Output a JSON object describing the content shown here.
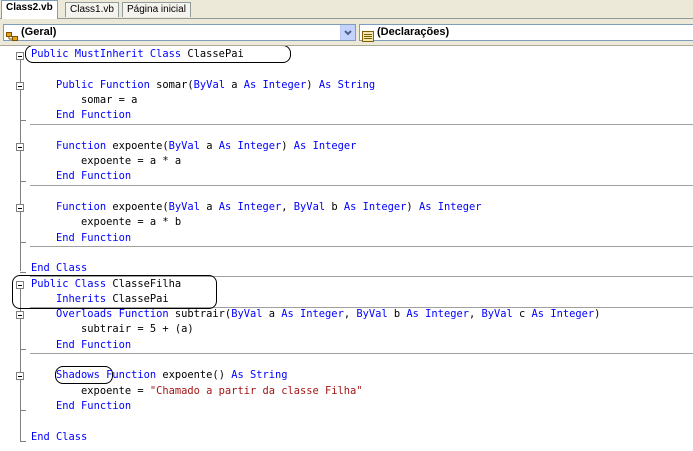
{
  "tabs": [
    {
      "label": "Class2.vb",
      "active": true
    },
    {
      "label": "Class1.vb",
      "active": false
    },
    {
      "label": "Página inicial",
      "active": false
    }
  ],
  "dropdowns": {
    "left": {
      "label": "(Geral)",
      "icon": "class-icon"
    },
    "right": {
      "label": "(Declarações)",
      "icon": "members-icon"
    }
  },
  "colors": {
    "keyword": "#0000ff",
    "string": "#a31515",
    "text": "#000000"
  },
  "code": [
    [
      {
        "t": "kw",
        "v": "Public MustInherit Class "
      },
      {
        "t": "plain",
        "v": "ClassePai"
      }
    ],
    [],
    [
      {
        "t": "plain",
        "v": "    "
      },
      {
        "t": "kw",
        "v": "Public Function "
      },
      {
        "t": "plain",
        "v": "somar("
      },
      {
        "t": "kw",
        "v": "ByVal "
      },
      {
        "t": "plain",
        "v": "a "
      },
      {
        "t": "kw",
        "v": "As Integer"
      },
      {
        "t": "plain",
        "v": ") "
      },
      {
        "t": "kw",
        "v": "As String"
      }
    ],
    [
      {
        "t": "plain",
        "v": "        somar = a"
      }
    ],
    [
      {
        "t": "plain",
        "v": "    "
      },
      {
        "t": "kw",
        "v": "End Function"
      }
    ],
    [],
    [
      {
        "t": "plain",
        "v": "    "
      },
      {
        "t": "kw",
        "v": "Function "
      },
      {
        "t": "plain",
        "v": "expoente("
      },
      {
        "t": "kw",
        "v": "ByVal "
      },
      {
        "t": "plain",
        "v": "a "
      },
      {
        "t": "kw",
        "v": "As Integer"
      },
      {
        "t": "plain",
        "v": ") "
      },
      {
        "t": "kw",
        "v": "As Integer"
      }
    ],
    [
      {
        "t": "plain",
        "v": "        expoente = a * a"
      }
    ],
    [
      {
        "t": "plain",
        "v": "    "
      },
      {
        "t": "kw",
        "v": "End Function"
      }
    ],
    [],
    [
      {
        "t": "plain",
        "v": "    "
      },
      {
        "t": "kw",
        "v": "Function "
      },
      {
        "t": "plain",
        "v": "expoente("
      },
      {
        "t": "kw",
        "v": "ByVal "
      },
      {
        "t": "plain",
        "v": "a "
      },
      {
        "t": "kw",
        "v": "As Integer"
      },
      {
        "t": "plain",
        "v": ", "
      },
      {
        "t": "kw",
        "v": "ByVal "
      },
      {
        "t": "plain",
        "v": "b "
      },
      {
        "t": "kw",
        "v": "As Integer"
      },
      {
        "t": "plain",
        "v": ") "
      },
      {
        "t": "kw",
        "v": "As Integer"
      }
    ],
    [
      {
        "t": "plain",
        "v": "        expoente = a * b"
      }
    ],
    [
      {
        "t": "plain",
        "v": "    "
      },
      {
        "t": "kw",
        "v": "End Function"
      }
    ],
    [],
    [
      {
        "t": "kw",
        "v": "End Class"
      }
    ],
    [
      {
        "t": "kw",
        "v": "Public Class "
      },
      {
        "t": "plain",
        "v": "ClasseFilha"
      }
    ],
    [
      {
        "t": "plain",
        "v": "    "
      },
      {
        "t": "kw",
        "v": "Inherits "
      },
      {
        "t": "plain",
        "v": "ClassePai"
      }
    ],
    [
      {
        "t": "plain",
        "v": "    "
      },
      {
        "t": "kw",
        "v": "Overloads Function "
      },
      {
        "t": "plain",
        "v": "subtrair("
      },
      {
        "t": "kw",
        "v": "ByVal "
      },
      {
        "t": "plain",
        "v": "a "
      },
      {
        "t": "kw",
        "v": "As Integer"
      },
      {
        "t": "plain",
        "v": ", "
      },
      {
        "t": "kw",
        "v": "ByVal "
      },
      {
        "t": "plain",
        "v": "b "
      },
      {
        "t": "kw",
        "v": "As Integer"
      },
      {
        "t": "plain",
        "v": ", "
      },
      {
        "t": "kw",
        "v": "ByVal "
      },
      {
        "t": "plain",
        "v": "c "
      },
      {
        "t": "kw",
        "v": "As Integer"
      },
      {
        "t": "plain",
        "v": ")"
      }
    ],
    [
      {
        "t": "plain",
        "v": "        subtrair = 5 + (a)"
      }
    ],
    [
      {
        "t": "plain",
        "v": "    "
      },
      {
        "t": "kw",
        "v": "End Function"
      }
    ],
    [],
    [
      {
        "t": "plain",
        "v": "    "
      },
      {
        "t": "kw",
        "v": "Shadows "
      },
      {
        "t": "kw",
        "v": "Function "
      },
      {
        "t": "plain",
        "v": "expoente() "
      },
      {
        "t": "kw",
        "v": "As String"
      }
    ],
    [
      {
        "t": "plain",
        "v": "        expoente = "
      },
      {
        "t": "str",
        "v": "\"Chamado a partir da classe Filha\""
      }
    ],
    [
      {
        "t": "plain",
        "v": "    "
      },
      {
        "t": "kw",
        "v": "End Function"
      }
    ],
    [],
    [
      {
        "t": "kw",
        "v": "End Class"
      }
    ]
  ]
}
